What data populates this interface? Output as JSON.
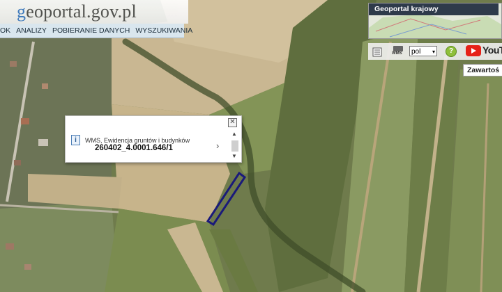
{
  "logo": {
    "prefix": "g",
    "rest": "eoportal.gov.pl"
  },
  "menu": {
    "items": [
      "OK",
      "ANALIZY",
      "POBIERANIE DANYCH",
      "WYSZUKIWANIA"
    ]
  },
  "minimap": {
    "title": "Geoportal krajowy"
  },
  "toolbar": {
    "language": "pol",
    "help": "?",
    "youtube_label": "YouTub",
    "wms_icon_label": "WMS"
  },
  "side_tab": {
    "label": "Zawartoś"
  },
  "popup": {
    "info_icon": "i",
    "layer_name": "WMS, Ewidencja gruntów i budynków",
    "parcel_id": "260402_4.0001.646/1",
    "close_glyph": "✕",
    "next_glyph": "›"
  },
  "colors": {
    "highlight": "#1a1a7a",
    "menu_bg": "#d9e6ee",
    "logo_blue": "#3d7bc6",
    "minimap_title_bg": "#2e3a4a"
  }
}
